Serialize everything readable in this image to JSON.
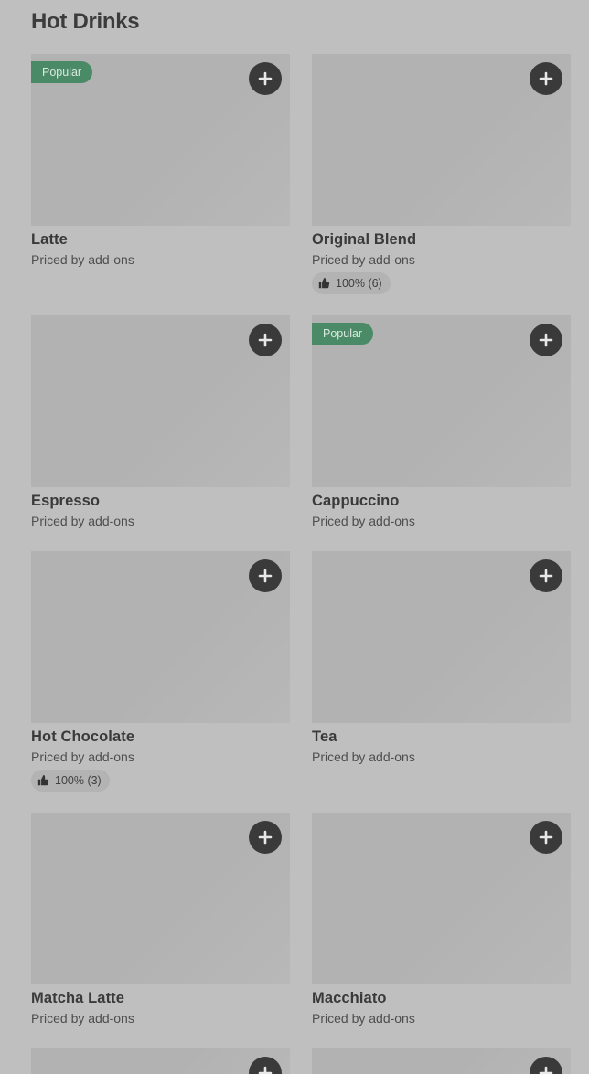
{
  "section": {
    "title": "Hot Drinks"
  },
  "items": [
    {
      "name": "Latte",
      "price": "Priced by add-ons",
      "badge": "Popular",
      "rating": null
    },
    {
      "name": "Original Blend",
      "price": "Priced by add-ons",
      "badge": null,
      "rating": "100% (6)"
    },
    {
      "name": "Espresso",
      "price": "Priced by add-ons",
      "badge": null,
      "rating": null
    },
    {
      "name": "Cappuccino",
      "price": "Priced by add-ons",
      "badge": "Popular",
      "rating": null
    },
    {
      "name": "Hot Chocolate",
      "price": "Priced by add-ons",
      "badge": null,
      "rating": "100% (3)"
    },
    {
      "name": "Tea",
      "price": "Priced by add-ons",
      "badge": null,
      "rating": null
    },
    {
      "name": "Matcha Latte",
      "price": "Priced by add-ons",
      "badge": null,
      "rating": null
    },
    {
      "name": "Macchiato",
      "price": "Priced by add-ons",
      "badge": null,
      "rating": null
    }
  ],
  "icons": {
    "add": "plus-icon",
    "rating": "thumbs-up-icon"
  },
  "colors": {
    "badge": "#4a8a67",
    "add_button": "#3a3a3a",
    "background": "#bfbfbf"
  }
}
